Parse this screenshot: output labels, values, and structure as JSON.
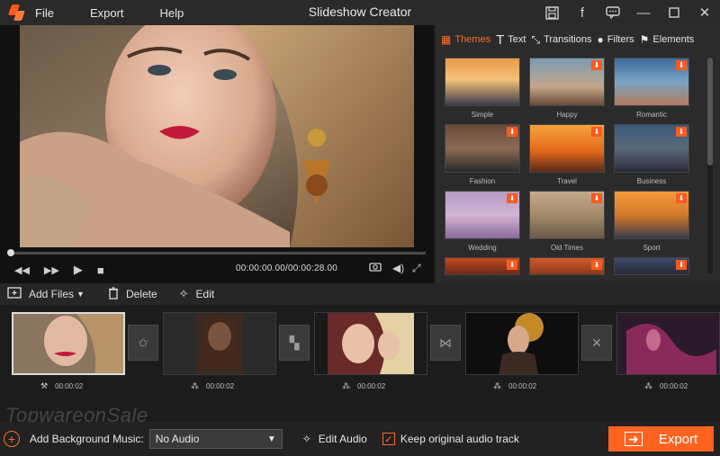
{
  "app": {
    "title": "Slideshow Creator"
  },
  "menu": {
    "file": "File",
    "export": "Export",
    "help": "Help"
  },
  "preview": {
    "timecode": "00:00:00.00/00:00:28.00",
    "progress": 0.0
  },
  "tabs": [
    {
      "label": "Themes",
      "icon": "palette-icon",
      "active": true
    },
    {
      "label": "Text",
      "icon": "text-icon"
    },
    {
      "label": "Transitions",
      "icon": "transitions-icon"
    },
    {
      "label": "Filters",
      "icon": "filters-icon"
    },
    {
      "label": "Elements",
      "icon": "elements-icon"
    }
  ],
  "themes": [
    {
      "label": "Simple",
      "download": false
    },
    {
      "label": "Happy",
      "download": true
    },
    {
      "label": "Romantic",
      "download": true
    },
    {
      "label": "Fashion",
      "download": true
    },
    {
      "label": "Travel",
      "download": true
    },
    {
      "label": "Business",
      "download": true
    },
    {
      "label": "Wedding",
      "download": true
    },
    {
      "label": "Old Times",
      "download": true
    },
    {
      "label": "Sport",
      "download": true
    }
  ],
  "toolbar": {
    "add_files": "Add Files",
    "delete": "Delete",
    "edit": "Edit"
  },
  "clips": [
    {
      "duration": "00:00:02"
    },
    {
      "duration": "00:00:02"
    },
    {
      "duration": "00:00:02"
    },
    {
      "duration": "00:00:02"
    },
    {
      "duration": "00:00:02"
    }
  ],
  "watermark": "TopwareonSale",
  "bottom": {
    "bg_music_label": "Add Background Music:",
    "music_value": "No Audio",
    "edit_audio": "Edit Audio",
    "keep_original": "Keep original audio track",
    "keep_checked": true,
    "export": "Export"
  },
  "colors": {
    "accent": "#ff6320",
    "panel": "#2b2b2b",
    "background": "#1f1f1f"
  }
}
